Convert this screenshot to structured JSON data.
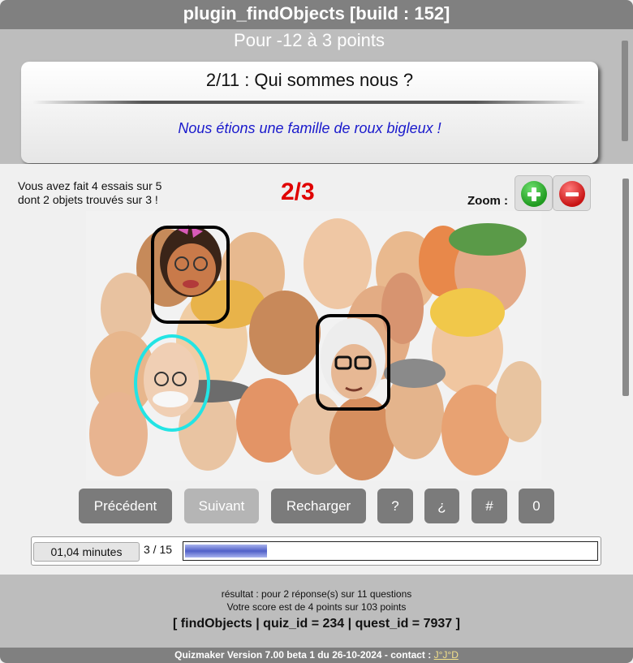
{
  "window": {
    "title": "plugin_findObjects [build : 152]"
  },
  "header": {
    "points": "Pour -12 à 3 points",
    "question_title": "2/11 : Qui sommes nous ?",
    "hint": "Nous étions une famille de roux bigleux !"
  },
  "status": {
    "attempts_line1": "Vous avez fait 4 essais sur 5",
    "attempts_line2": "dont 2 objets trouvés sur 3 !",
    "found": "2/3",
    "zoom_label": "Zoom :"
  },
  "buttons": {
    "previous": "Précédent",
    "next": "Suivant",
    "reload": "Recharger",
    "help": "?",
    "inverted_question": "¿",
    "hash": "#",
    "zero": "0"
  },
  "progress": {
    "timer": "01,04 minutes",
    "counter": "3 / 15",
    "fraction": 0.2
  },
  "footer": {
    "result_line": "résultat : pour 2 réponse(s) sur 11 questions",
    "score_line": "Votre score est de 4 points sur 103 points",
    "ids_line": "[ findObjects | quiz_id = 234 | quest_id = 7937 ]",
    "version_text": "Quizmaker Version 7.00 beta 1 du 26-10-2024 - contact : ",
    "contact_link": "J°J°D"
  },
  "colors": {
    "found_text": "#e00000",
    "hint_text": "#1a1acc",
    "zoom_in": "#22aa22",
    "zoom_out": "#d41a1a",
    "progress_fill": "#5060c8",
    "found_marker": "#000000",
    "missed_marker": "#22e4e4"
  },
  "icons": {
    "zoom_in": "plus-icon",
    "zoom_out": "minus-icon"
  }
}
